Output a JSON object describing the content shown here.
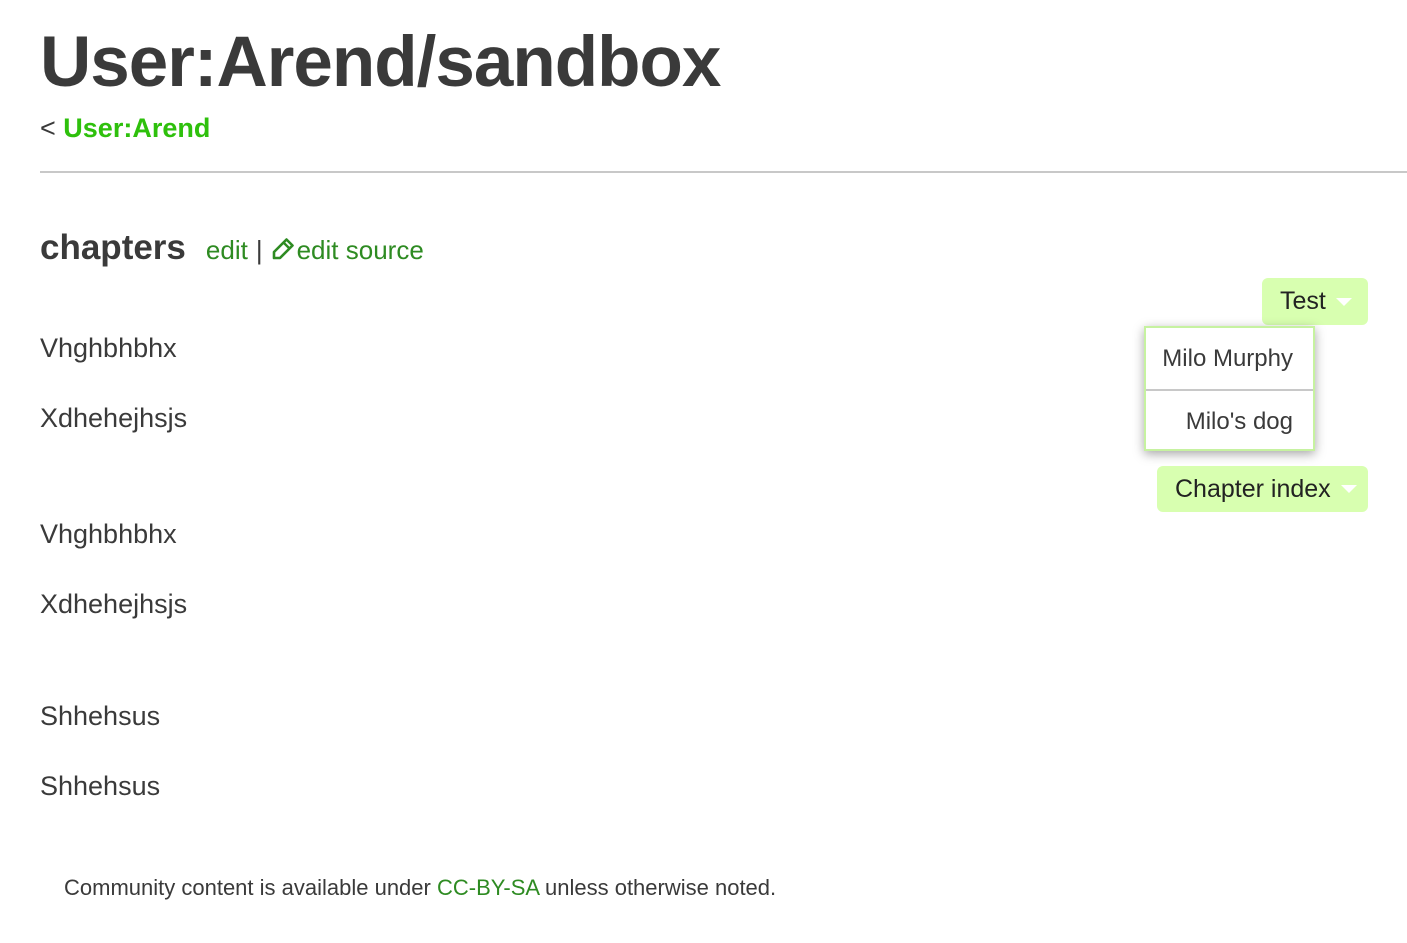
{
  "page": {
    "title": "User:Arend/sandbox",
    "breadcrumb_prefix": "<",
    "breadcrumb_link": "User:Arend"
  },
  "section": {
    "title": "chapters",
    "edit_label": "edit",
    "separator": "|",
    "edit_source_label": "edit source"
  },
  "content": {
    "paragraphs": [
      "Vhghbhbhx",
      "Xdhehejhsjs",
      "Vhghbhbhx",
      "Xdhehejhsjs",
      "Shhehsus",
      "Shhehsus"
    ]
  },
  "dropdowns": {
    "test": {
      "label": "Test",
      "items": [
        "Milo Murphy",
        "Milo's dog"
      ]
    },
    "chapter_index": {
      "label": "Chapter index"
    }
  },
  "footer": {
    "prefix": "Community content is available under",
    "license_link": "CC-BY-SA",
    "suffix": "unless otherwise noted."
  },
  "colors": {
    "link_bright": "#2ec00c",
    "link": "#2e8b22",
    "button_bg": "#d8ffb0",
    "text": "#3a3a3a"
  },
  "icons": {
    "edit_source": "pencil-icon",
    "dropdown": "caret-down-icon"
  }
}
